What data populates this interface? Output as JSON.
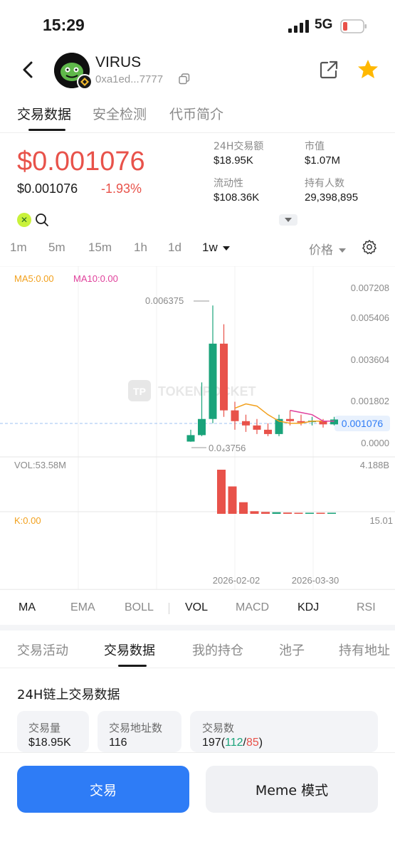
{
  "status_bar": {
    "time": "15:29",
    "network": "5G"
  },
  "token": {
    "name": "VIRUS",
    "address": "0xa1ed...7777"
  },
  "top_tabs": [
    {
      "label": "交易数据",
      "active": true
    },
    {
      "label": "安全检测",
      "active": false
    },
    {
      "label": "代币简介",
      "active": false
    }
  ],
  "price": {
    "main": "$0.001076",
    "secondary": "$0.001076",
    "change": "-1.93%"
  },
  "stats": [
    {
      "label": "24H交易额",
      "value": "$18.95K"
    },
    {
      "label": "市值",
      "value": "$1.07M"
    },
    {
      "label": "流动性",
      "value": "$108.36K"
    },
    {
      "label": "持有人数",
      "value": "29,398,895"
    }
  ],
  "intervals": [
    {
      "label": "1m",
      "active": false
    },
    {
      "label": "5m",
      "active": false
    },
    {
      "label": "15m",
      "active": false
    },
    {
      "label": "1h",
      "active": false
    },
    {
      "label": "1d",
      "active": false
    },
    {
      "label": "1w",
      "active": true
    }
  ],
  "price_mode": "价格",
  "chart": {
    "ma5": "MA5:0.00",
    "ma10": "MA10:0.00",
    "y_ticks": [
      "0.007208",
      "0.005406",
      "0.003604",
      "0.001802",
      "0.0000"
    ],
    "current_label": "0.001076",
    "high_label": "0.006375",
    "low_label": "0.0₄3756",
    "watermark": "TOKENPOCKET",
    "vol_label": "VOL:53.58M",
    "vol_max": "4.188B",
    "k_label": "K:0.00",
    "k_right": "15.01",
    "x_ticks": [
      "2026-02-02",
      "2026-03-30"
    ]
  },
  "chart_data": {
    "type": "candlestick",
    "interval": "1w",
    "ylim": [
      0,
      0.007208
    ],
    "current_price": 0.001076,
    "high": 0.006375,
    "low": 3.756e-05,
    "x_ticks": [
      "2026-02-02",
      "2026-03-30"
    ],
    "candles": [
      {
        "o": 5e-05,
        "c": 0.00035,
        "h": 0.0006,
        "l": 4e-05,
        "dir": "up"
      },
      {
        "o": 0.00035,
        "c": 0.0011,
        "h": 0.0028,
        "l": 0.0003,
        "dir": "up"
      },
      {
        "o": 0.0011,
        "c": 0.0046,
        "h": 0.006375,
        "l": 0.0009,
        "dir": "up"
      },
      {
        "o": 0.0046,
        "c": 0.0015,
        "h": 0.0055,
        "l": 0.0012,
        "dir": "down"
      },
      {
        "o": 0.0015,
        "c": 0.001,
        "h": 0.0019,
        "l": 0.0006,
        "dir": "down"
      },
      {
        "o": 0.001,
        "c": 0.0008,
        "h": 0.0013,
        "l": 0.0005,
        "dir": "down"
      },
      {
        "o": 0.0008,
        "c": 0.0006,
        "h": 0.0011,
        "l": 0.0004,
        "dir": "down"
      },
      {
        "o": 0.0006,
        "c": 0.0004,
        "h": 0.0009,
        "l": 0.0003,
        "dir": "down"
      },
      {
        "o": 0.0004,
        "c": 0.0011,
        "h": 0.0013,
        "l": 0.0003,
        "dir": "up"
      },
      {
        "o": 0.0011,
        "c": 0.001,
        "h": 0.0015,
        "l": 0.0008,
        "dir": "down"
      },
      {
        "o": 0.001,
        "c": 0.00098,
        "h": 0.0013,
        "l": 0.0008,
        "dir": "down"
      },
      {
        "o": 0.00098,
        "c": 0.00102,
        "h": 0.0012,
        "l": 0.0008,
        "dir": "up"
      },
      {
        "o": 0.00102,
        "c": 0.00085,
        "h": 0.0011,
        "l": 0.0007,
        "dir": "down"
      },
      {
        "o": 0.00085,
        "c": 0.001076,
        "h": 0.0012,
        "l": 0.0008,
        "dir": "up"
      }
    ],
    "ma_lines": [
      {
        "name": "MA5",
        "color": "#f2a01c",
        "values": [
          null,
          null,
          null,
          null,
          0.0016,
          0.0018,
          0.0017,
          0.0013,
          0.001,
          0.0009,
          0.0009,
          0.001,
          0.001,
          0.001
        ]
      },
      {
        "name": "MA10",
        "color": "#e0409b",
        "values": [
          null,
          null,
          null,
          null,
          null,
          null,
          null,
          null,
          null,
          0.0015,
          0.0014,
          0.0013,
          0.001,
          0.001
        ]
      }
    ],
    "volume_max": "4.188B",
    "volume": [
      0,
      0,
      0,
      4.188,
      2.6,
      1.1,
      0.25,
      0.18,
      0.15,
      0.12,
      0.08,
      0.05,
      0.04,
      0.03
    ]
  },
  "indicators": [
    {
      "label": "MA",
      "active": true
    },
    {
      "label": "EMA",
      "active": false
    },
    {
      "label": "BOLL",
      "active": false
    },
    {
      "label": "VOL",
      "active": true
    },
    {
      "label": "MACD",
      "active": false
    },
    {
      "label": "KDJ",
      "active": true
    },
    {
      "label": "RSI",
      "active": false
    }
  ],
  "bottom_tabs": [
    {
      "label": "交易活动",
      "active": false
    },
    {
      "label": "交易数据",
      "active": true
    },
    {
      "label": "我的持仓",
      "active": false
    },
    {
      "label": "池子",
      "active": false
    },
    {
      "label": "持有地址",
      "active": false
    }
  ],
  "section_title": "24H链上交易数据",
  "cards": [
    {
      "label": "交易量",
      "value": "$18.95K"
    },
    {
      "label": "交易地址数",
      "value": "116"
    },
    {
      "label": "交易数",
      "value_total": "197",
      "value_buy": "112",
      "value_sell": "85"
    }
  ],
  "buttons": {
    "trade": "交易",
    "meme": "Meme 模式"
  },
  "colors": {
    "up": "#1aa37a",
    "down": "#e8524a",
    "accent": "#2e7cf6",
    "ma5": "#f2a01c",
    "ma10": "#e0409b"
  }
}
